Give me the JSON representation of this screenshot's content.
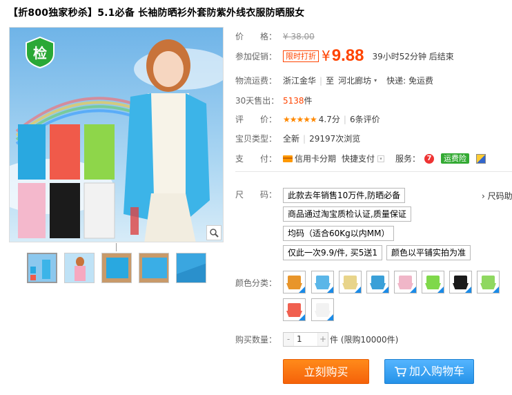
{
  "title": "【折800独家秒杀】5.1必备 长袖防晒衫外套防紫外线衣服防晒服女",
  "image": {
    "badge_text": "检"
  },
  "price": {
    "label": "价　　格：",
    "original": "¥ 38.00"
  },
  "promo": {
    "label": "参加促销：",
    "tag": "限时打折",
    "currency": "¥",
    "value": "9.88",
    "countdown": "39小时52分钟 后结束"
  },
  "shipping": {
    "label": "物流运费：",
    "from": "浙江金华",
    "to_prefix": "至",
    "to": "河北廊坊",
    "method": "快递: 免运费"
  },
  "sales": {
    "label": "30天售出：",
    "count": "5138",
    "unit": "件"
  },
  "rating": {
    "label": "评　　价：",
    "stars": "★★★★★",
    "score": "4.7分",
    "reviews": "6条评价"
  },
  "condition": {
    "label": "宝贝类型：",
    "type": "全新",
    "views": "29197次浏览"
  },
  "payment": {
    "label": "支　　付：",
    "card": "信用卡分期",
    "quick": "快捷支付",
    "service_label": "服务：",
    "freight_badge": "运费险"
  },
  "size": {
    "label": "尺　　码：",
    "options": [
      "此款去年销售10万件,防晒必备",
      "商品通过淘宝质检认证,质量保证",
      "均码（适合60Kg以内MM）",
      "仅此一次9.9/件, 买5送1",
      "颜色以平铺实拍为准"
    ],
    "link": "尺码助"
  },
  "colors": {
    "label": "颜色分类：",
    "swatches": [
      "#e8952a",
      "#5ab6e8",
      "#e8d48a",
      "#3aa0d8",
      "#f0b6c8",
      "#7fd84a",
      "#1a1a1a",
      "#8fd860",
      "#f06050",
      "#f2f2f2"
    ]
  },
  "quantity": {
    "label": "购买数量：",
    "minus": "-",
    "value": "1",
    "plus": "+",
    "unit": "件 (限购10000件)"
  },
  "buttons": {
    "buy_now": "立刻购买",
    "add_cart": "加入购物车"
  }
}
